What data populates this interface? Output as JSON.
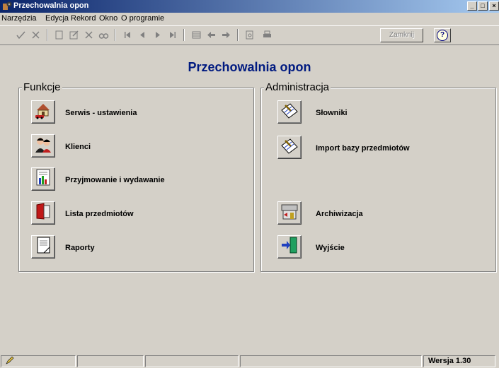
{
  "window": {
    "title": "Przechowalnia opon"
  },
  "menu": [
    "Narzędzia",
    "Edycja",
    "Rekord",
    "Okno",
    "O programie"
  ],
  "toolbar": {
    "close_label": "Zamknij",
    "help_glyph": "?"
  },
  "main": {
    "title": "Przechowalnia opon"
  },
  "groups": {
    "funkcje": {
      "title": "Funkcje",
      "items": [
        {
          "label": "Serwis - ustawienia",
          "icon": "house-car-icon"
        },
        {
          "label": "Klienci",
          "icon": "people-icon"
        },
        {
          "label": "Przyjmowanie i wydawanie",
          "icon": "chart-document-icon"
        },
        {
          "label": "Lista przedmiotów",
          "icon": "book-icon"
        },
        {
          "label": "Raporty",
          "icon": "report-icon"
        }
      ]
    },
    "administracja": {
      "title": "Administracja",
      "items": [
        {
          "label": "Słowniki",
          "icon": "pen-paper-icon"
        },
        {
          "label": "Import bazy przedmiotów",
          "icon": "pen-paper-icon"
        },
        {
          "label": "Archiwizacja",
          "icon": "archive-icon"
        },
        {
          "label": "Wyjście",
          "icon": "exit-door-icon"
        }
      ]
    }
  },
  "statusbar": {
    "version": "Wersja 1.30"
  }
}
